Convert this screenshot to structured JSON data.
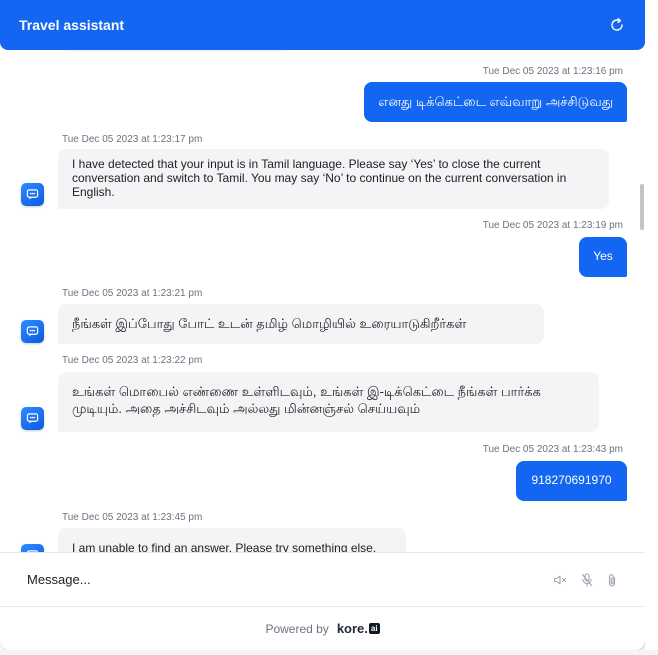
{
  "header": {
    "title": "Travel assistant",
    "refresh_icon": "refresh-icon",
    "color": "#1266f1"
  },
  "messages": [
    {
      "sender": "user",
      "timestamp": "Tue Dec 05 2023 at 1:23:16 pm",
      "text": "எனது டிக்கெட்டை எவ்வாறு அச்சிடுவது"
    },
    {
      "sender": "bot",
      "timestamp": "Tue Dec 05 2023 at 1:23:17 pm",
      "text": "I have detected that your input is in Tamil language. Please say ‘Yes’ to close the current conversation and switch to Tamil. You may say ‘No’ to continue on the current conversation in English."
    },
    {
      "sender": "user",
      "timestamp": "Tue Dec 05 2023 at 1:23:19 pm",
      "text": "Yes"
    },
    {
      "sender": "bot",
      "timestamp": "Tue Dec 05 2023 at 1:23:21 pm",
      "text": "நீங்கள் இப்போது போட் உடன் தமிழ் மொழியில் உரையாடுகிறீர்கள்"
    },
    {
      "sender": "bot",
      "timestamp": "Tue Dec 05 2023 at 1:23:22 pm",
      "text": "உங்கள் மொபைல் எண்ணை உள்ளிடவும், உங்கள் இ-டிக்கெட்டை நீங்கள் பார்க்க முடியும். அதை அச்சிடவும் அல்லது மின்னஞ்சல் செய்யவும்"
    },
    {
      "sender": "user",
      "timestamp": "Tue Dec 05 2023 at 1:23:43 pm",
      "text": "918270691970"
    },
    {
      "sender": "bot",
      "timestamp": "Tue Dec 05 2023 at 1:23:45 pm",
      "text": "I am unable to find an answer. Please try something else."
    }
  ],
  "composer": {
    "placeholder": "Message...",
    "icons": [
      "speaker-mute-icon",
      "microphone-icon",
      "attachment-icon"
    ]
  },
  "footer": {
    "powered_by": "Powered by",
    "brand_text": "kore.",
    "brand_suffix": "ai"
  },
  "colors": {
    "accent": "#1266f1",
    "bot_bubble": "#f3f4f6",
    "timestamp": "#6b7280"
  }
}
